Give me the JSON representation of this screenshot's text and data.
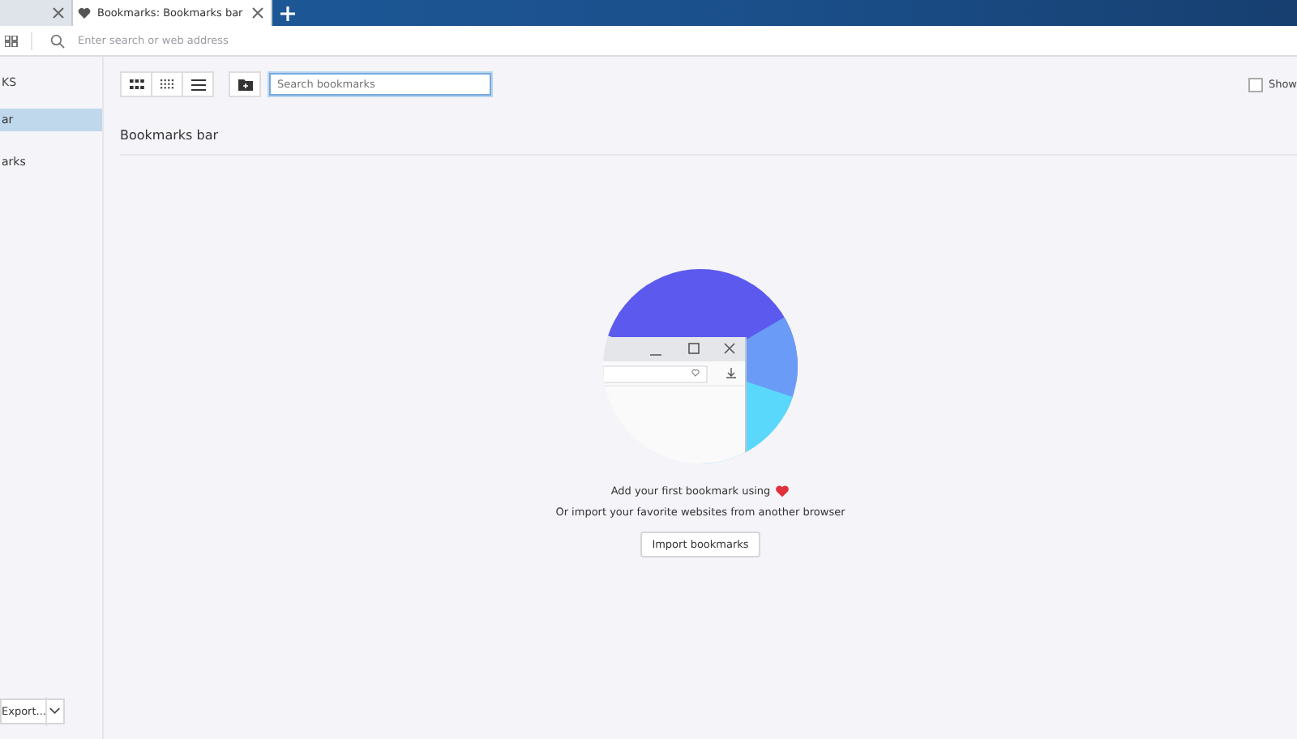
{
  "tabs": [
    {
      "selected": false
    },
    {
      "label": "Bookmarks: Bookmarks bar",
      "selected": true
    }
  ],
  "address_bar": {
    "placeholder": "Enter search or web address"
  },
  "sidebar": {
    "heading": "KS",
    "items": [
      {
        "label": "ar",
        "selected": true
      },
      {
        "label": "arks",
        "selected": false
      }
    ],
    "export_button": "Export..."
  },
  "search": {
    "placeholder": "Search bookmarks"
  },
  "show_option": {
    "label": "Show",
    "checked": false
  },
  "folder_title": "Bookmarks bar",
  "empty_state": {
    "line_1": "Add your first bookmark using",
    "line_2": "Or import your favorite websites from another browser",
    "button": "Import bookmarks"
  }
}
